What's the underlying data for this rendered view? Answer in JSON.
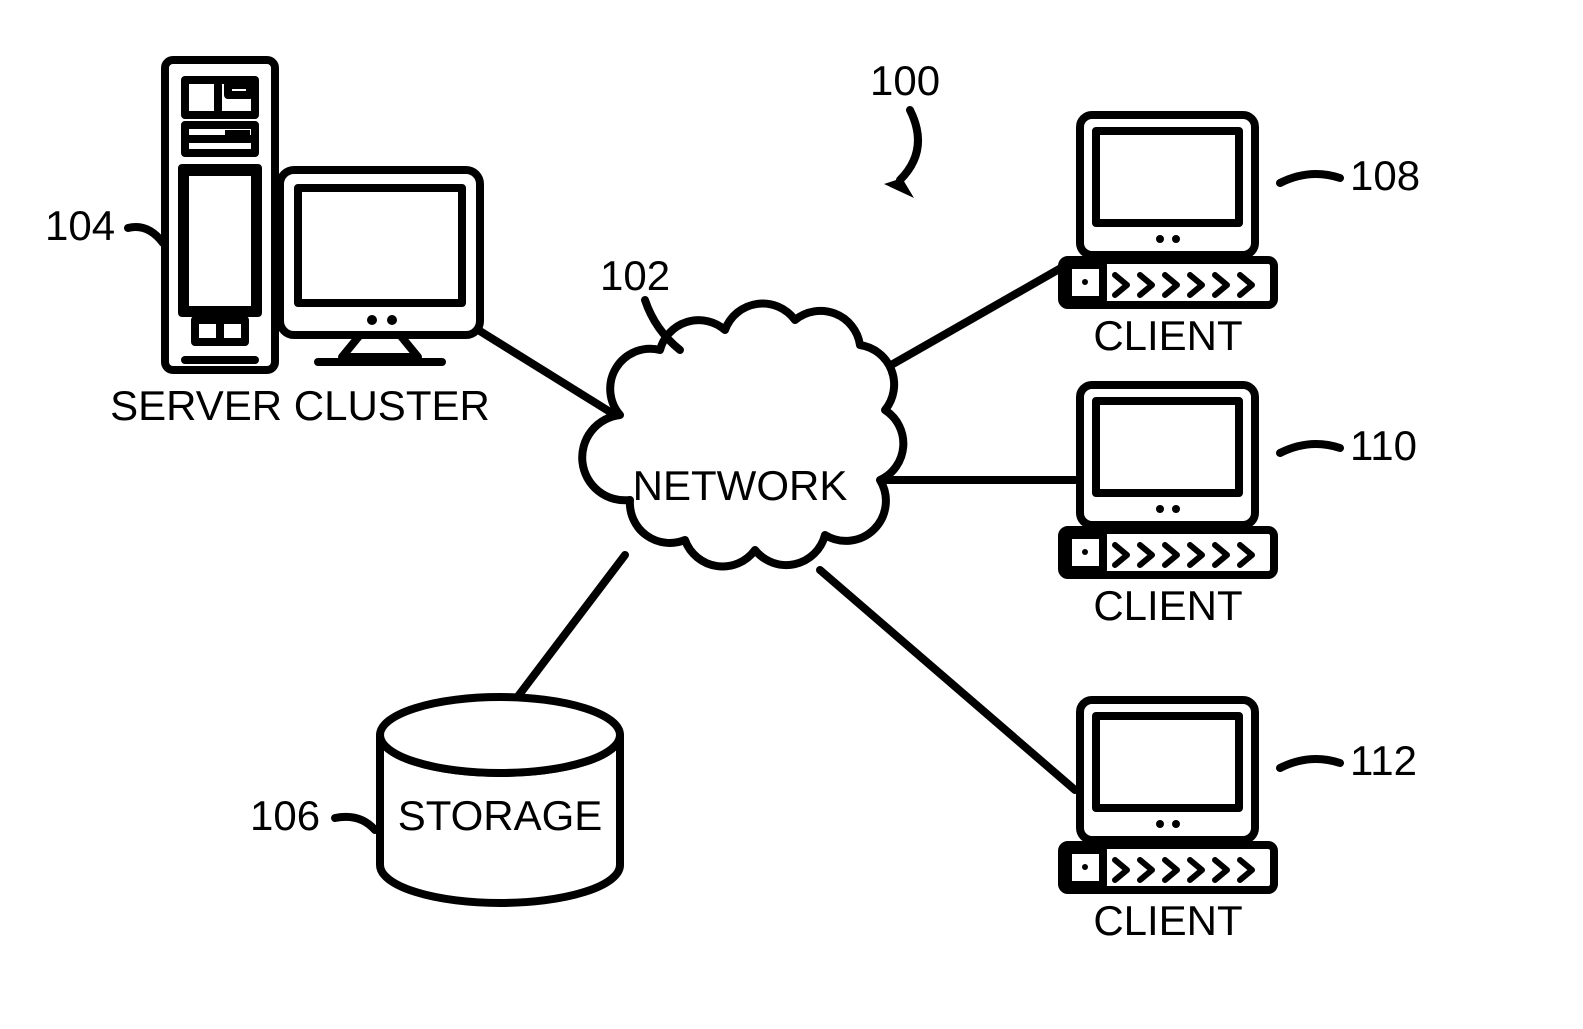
{
  "diagram": {
    "reference": "100",
    "network": {
      "label": "NETWORK",
      "ref": "102"
    },
    "server": {
      "label": "SERVER CLUSTER",
      "ref": "104"
    },
    "storage": {
      "label": "STORAGE",
      "ref": "106"
    },
    "clients": [
      {
        "label": "CLIENT",
        "ref": "108"
      },
      {
        "label": "CLIENT",
        "ref": "110"
      },
      {
        "label": "CLIENT",
        "ref": "112"
      }
    ]
  }
}
